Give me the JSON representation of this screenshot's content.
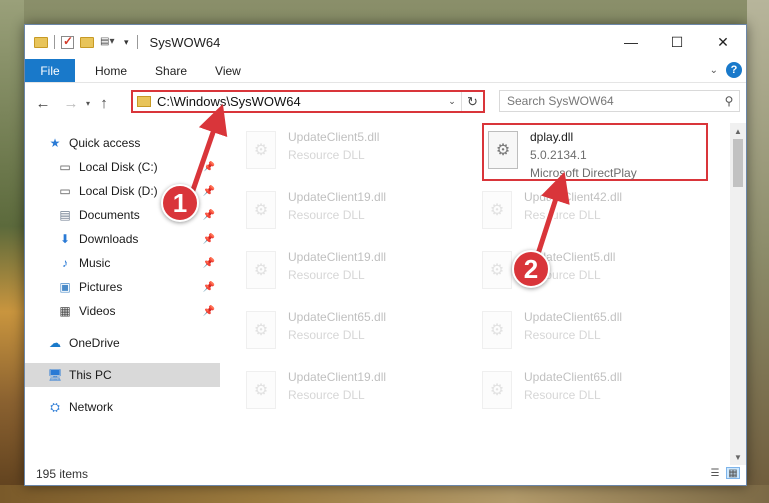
{
  "window": {
    "title": "SysWOW64",
    "controls": {
      "minimize": "—",
      "maximize": "☐",
      "close": "✕"
    }
  },
  "ribbon": {
    "tabs": [
      "File",
      "Home",
      "Share",
      "View"
    ],
    "help": "?"
  },
  "address": {
    "path": "C:\\Windows\\SysWOW64",
    "refresh": "↻"
  },
  "search": {
    "placeholder": "Search SysWOW64"
  },
  "sidebar": {
    "items": [
      {
        "label": "Quick access",
        "icon": "star-icon",
        "pinned": false
      },
      {
        "label": "Local Disk (C:)",
        "icon": "drive-icon",
        "pinned": true
      },
      {
        "label": "Local Disk (D:)",
        "icon": "drive-icon",
        "pinned": true
      },
      {
        "label": "Documents",
        "icon": "documents-icon",
        "pinned": true
      },
      {
        "label": "Downloads",
        "icon": "downloads-icon",
        "pinned": true
      },
      {
        "label": "Music",
        "icon": "music-icon",
        "pinned": true
      },
      {
        "label": "Pictures",
        "icon": "pictures-icon",
        "pinned": true
      },
      {
        "label": "Videos",
        "icon": "videos-icon",
        "pinned": true
      },
      {
        "label": "OneDrive",
        "icon": "cloud-icon",
        "pinned": false
      },
      {
        "label": "This PC",
        "icon": "pc-icon",
        "pinned": false
      },
      {
        "label": "Network",
        "icon": "network-icon",
        "pinned": false
      }
    ]
  },
  "files": {
    "selected": {
      "name": "dplay.dll",
      "version": "5.0.2134.1",
      "description": "Microsoft DirectPlay"
    },
    "others": [
      {
        "name": "UpdateClient5.dll",
        "type": "Resource DLL"
      },
      {
        "name": "UpdateClient19.dll",
        "type": "Resource DLL"
      },
      {
        "name": "UpdateClient42.dll",
        "type": "Resource DLL"
      },
      {
        "name": "UpdateClient19.dll",
        "type": "Resource DLL"
      },
      {
        "name": "UpdateClient5.dll",
        "type": "Resource DLL"
      },
      {
        "name": "UpdateClient65.dll",
        "type": "Resource DLL"
      },
      {
        "name": "UpdateClient65.dll",
        "type": "Resource DLL"
      },
      {
        "name": "UpdateClient19.dll",
        "type": "Resource DLL"
      },
      {
        "name": "UpdateClient65.dll",
        "type": "Resource DLL"
      }
    ]
  },
  "status": {
    "item_count": "195 items"
  },
  "callouts": [
    "1",
    "2"
  ],
  "colors": {
    "accent": "#1979ca",
    "highlight": "#d9353a",
    "selection": "#cce8ff"
  }
}
